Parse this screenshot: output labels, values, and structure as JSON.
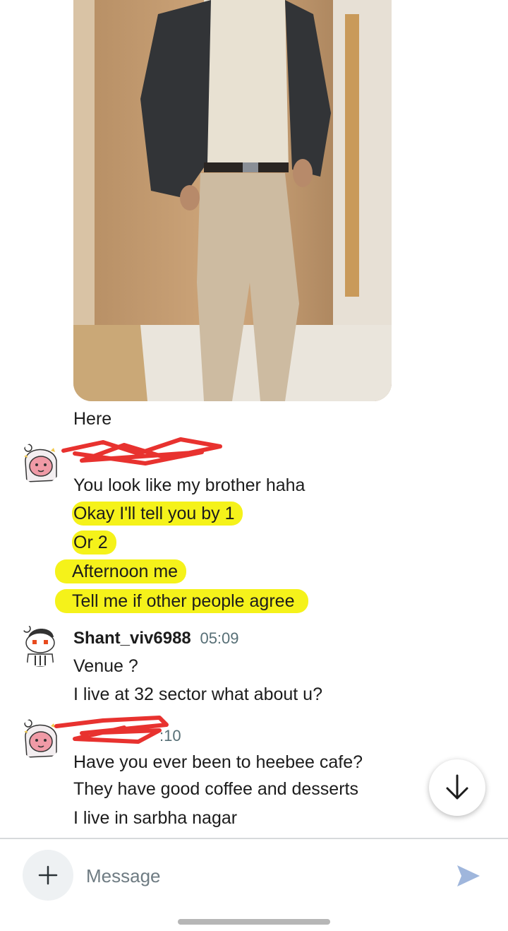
{
  "messages": {
    "photo_caption": "Here",
    "group1": {
      "username": "",
      "time": "",
      "lines": [
        "You look like my brother haha",
        "Okay I'll tell you by 1",
        "Or 2",
        "Afternoon me",
        "Tell me if other people agree"
      ]
    },
    "group2": {
      "username": "Shant_viv6988",
      "time": "05:09",
      "lines": [
        "Venue ?",
        "I live at 32 sector what about u?"
      ]
    },
    "group3": {
      "username": "",
      "time": ":10",
      "lines": [
        "Have you ever been to heebee cafe?",
        "They have good coffee and desserts",
        "I live in sarbha nagar"
      ]
    }
  },
  "composer": {
    "placeholder": "Message"
  },
  "icons": {
    "plus": "plus-icon",
    "send": "send-icon",
    "scroll_down": "arrow-down-icon"
  },
  "colors": {
    "highlight": "#f5f21a",
    "scribble": "#e8322f",
    "send_icon": "#9fb6dc",
    "timestamp": "#576f76"
  }
}
